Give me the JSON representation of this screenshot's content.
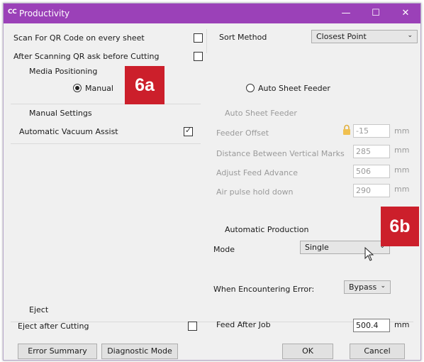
{
  "window": {
    "app_icon": "CC",
    "title": "Productivity",
    "min_glyph": "—",
    "max_glyph": "☐",
    "close_glyph": "✕"
  },
  "left": {
    "scan_qr": {
      "label": "Scan For QR Code on every sheet",
      "checked": false
    },
    "ask_before_cutting": {
      "label": "After Scanning QR ask before Cutting",
      "checked": false
    },
    "media_positioning": "Media Positioning",
    "manual_label": "Manual",
    "manual_settings": "Manual Settings",
    "vacuum": {
      "label": "Automatic Vacuum Assist",
      "checked": true
    },
    "eject": "Eject",
    "eject_after": {
      "label": "Eject after Cutting",
      "checked": false
    }
  },
  "right": {
    "sort_method_label": "Sort Method",
    "sort_method_value": "Closest Point",
    "auto_sheet_feeder_radio": "Auto Sheet Feeder",
    "auto_sheet_feeder_header": "Auto Sheet Feeder",
    "feeder_offset": {
      "label": "Feeder Offset",
      "value": "-15",
      "unit": "mm"
    },
    "distance_marks": {
      "label": "Distance Between Vertical Marks",
      "value": "285",
      "unit": "mm"
    },
    "adjust_feed": {
      "label": "Adjust Feed Advance",
      "value": "506",
      "unit": "mm"
    },
    "air_pulse": {
      "label": "Air pulse hold down",
      "value": "290",
      "unit": "mm"
    },
    "automatic_production": "Automatic Production",
    "mode_label": "Mode",
    "mode_value": "Single",
    "error_label": "When Encountering Error:",
    "error_value": "Bypass",
    "feed_after_job": {
      "label": "Feed After Job",
      "value": "500.4",
      "unit": "mm"
    }
  },
  "buttons": {
    "error_summary": "Error Summary",
    "diagnostic_mode": "Diagnostic Mode",
    "ok": "OK",
    "cancel": "Cancel"
  },
  "badges": {
    "a": "6a",
    "b": "6b"
  },
  "icons": {
    "lock": "lock-icon",
    "chevron": "chevron-down-icon",
    "cursor": "mouse-pointer-icon"
  },
  "colors": {
    "titlebar": "#9b41b8",
    "badge": "#cc1f2b",
    "window_bg": "#f0f0f0"
  }
}
